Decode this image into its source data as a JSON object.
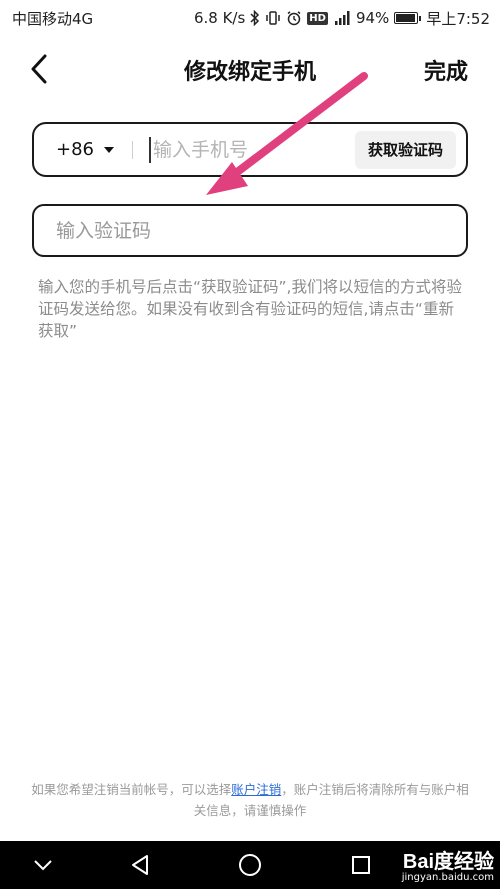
{
  "status_bar": {
    "carrier": "中国移动4G",
    "speed": "6.8 K/s",
    "battery": "94%",
    "battery_level": 0.94,
    "time": "早上7:52",
    "hd_label": "HD",
    "icons": [
      "bluetooth-icon",
      "vibrate-icon",
      "alarm-icon",
      "hd-icon",
      "signal-icon",
      "battery-icon"
    ]
  },
  "header": {
    "title": "修改绑定手机",
    "done_label": "完成",
    "back_icon": "chevron-left-icon"
  },
  "phone_field": {
    "country_code": "+86",
    "placeholder": "输入手机号",
    "value": "",
    "get_code_label": "获取验证码"
  },
  "code_field": {
    "placeholder": "输入验证码",
    "value": ""
  },
  "hint": "输入您的手机号后点击“获取验证码”,我们将以短信的方式将验证码发送给您。如果没有收到含有验证码的短信,请点击“重新获取”",
  "footer": {
    "before_link": "如果您希望注销当前帐号，可以选择",
    "link": "账户注销",
    "after_link": "，账户注销后将清除所有与账户相关信息，请谨慎操作"
  },
  "annotation": {
    "arrow_color": "#e0407e"
  },
  "nav_bar": {
    "icons": [
      "collapse-chevron-icon",
      "back-triangle-icon",
      "home-circle-icon",
      "recents-square-icon"
    ]
  },
  "watermark": {
    "logo": "Bai度经验",
    "url": "jingyan.baidu.com"
  }
}
